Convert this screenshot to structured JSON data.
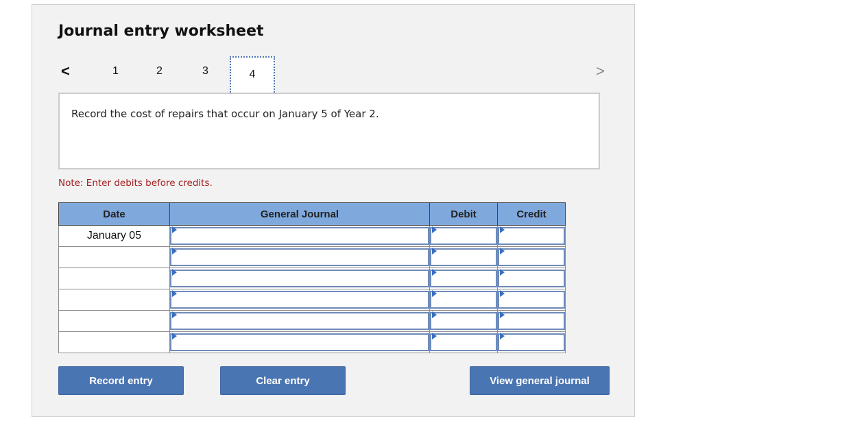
{
  "worksheet": {
    "title": "Journal entry worksheet",
    "nav": {
      "prev_icon": "chevron-left-icon",
      "next_icon": "chevron-right-icon",
      "prev_glyph": "<",
      "next_glyph": ">",
      "tabs": [
        {
          "label": "1",
          "active": false
        },
        {
          "label": "2",
          "active": false
        },
        {
          "label": "3",
          "active": false
        },
        {
          "label": "4",
          "active": true
        }
      ]
    },
    "prompt": "Record the cost of repairs that occur on January 5 of Year 2.",
    "note": "Note: Enter debits before credits.",
    "table": {
      "headers": {
        "date": "Date",
        "general_journal": "General Journal",
        "debit": "Debit",
        "credit": "Credit"
      },
      "rows": [
        {
          "date": "January 05",
          "account": "",
          "debit": "",
          "credit": ""
        },
        {
          "date": "",
          "account": "",
          "debit": "",
          "credit": ""
        },
        {
          "date": "",
          "account": "",
          "debit": "",
          "credit": ""
        },
        {
          "date": "",
          "account": "",
          "debit": "",
          "credit": ""
        },
        {
          "date": "",
          "account": "",
          "debit": "",
          "credit": ""
        },
        {
          "date": "",
          "account": "",
          "debit": "",
          "credit": ""
        }
      ]
    },
    "buttons": {
      "record": "Record entry",
      "clear": "Clear entry",
      "view": "View general journal"
    },
    "colors": {
      "header_bg": "#7fa8dc",
      "button_bg": "#4a75b3",
      "note_text": "#a32020",
      "active_tab_border": "#4a74b4"
    }
  }
}
